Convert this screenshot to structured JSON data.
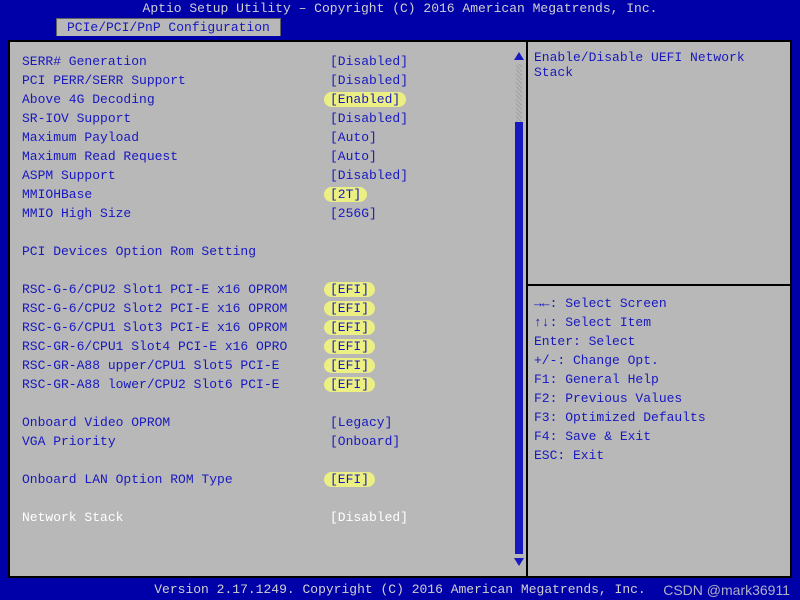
{
  "title": "Aptio Setup Utility – Copyright (C) 2016 American Megatrends, Inc.",
  "tab": "PCIe/PCI/PnP Configuration",
  "footer": "Version 2.17.1249. Copyright (C) 2016 American Megatrends, Inc.",
  "watermark": "CSDN @mark36911",
  "help_text": "Enable/Disable UEFI Network Stack",
  "section1": "PCI Devices Option Rom Setting",
  "items": {
    "serr": {
      "label": "SERR# Generation",
      "value": "[Disabled]"
    },
    "perr": {
      "label": "PCI PERR/SERR Support",
      "value": "[Disabled]"
    },
    "above4g": {
      "label": "Above 4G Decoding",
      "value": "[Enabled]"
    },
    "sriov": {
      "label": "SR-IOV Support",
      "value": "[Disabled]"
    },
    "maxpay": {
      "label": "Maximum Payload",
      "value": "[Auto]"
    },
    "maxread": {
      "label": "Maximum Read Request",
      "value": "[Auto]"
    },
    "aspm": {
      "label": "ASPM Support",
      "value": "[Disabled]"
    },
    "mmiobase": {
      "label": "MMIOHBase",
      "value": "[2T]"
    },
    "mmiohigh": {
      "label": "MMIO High Size",
      "value": "[256G]"
    },
    "slot1": {
      "label": "RSC-G-6/CPU2 Slot1 PCI-E x16 OPROM",
      "value": "[EFI]"
    },
    "slot2": {
      "label": "RSC-G-6/CPU2 Slot2 PCI-E x16 OPROM",
      "value": "[EFI]"
    },
    "slot3": {
      "label": "RSC-G-6/CPU1 Slot3 PCI-E x16 OPROM",
      "value": "[EFI]"
    },
    "slot4": {
      "label": "RSC-GR-6/CPU1 Slot4 PCI-E x16 OPRO",
      "value": "[EFI]"
    },
    "slot5": {
      "label": "RSC-GR-A88 upper/CPU1 Slot5 PCI-E",
      "value": "[EFI]"
    },
    "slot6": {
      "label": "RSC-GR-A88 lower/CPU2 Slot6 PCI-E",
      "value": "[EFI]"
    },
    "video": {
      "label": "Onboard Video OPROM",
      "value": "[Legacy]"
    },
    "vga": {
      "label": "VGA Priority",
      "value": "[Onboard]"
    },
    "lanrom": {
      "label": "Onboard LAN Option ROM Type",
      "value": "[EFI]"
    },
    "netstack": {
      "label": "Network Stack",
      "value": "[Disabled]"
    }
  },
  "keys": {
    "l1": "→←: Select Screen",
    "l2": "↑↓: Select Item",
    "l3": "Enter: Select",
    "l4": "+/-: Change Opt.",
    "l5": "F1: General Help",
    "l6": "F2: Previous Values",
    "l7": "F3: Optimized Defaults",
    "l8": "F4: Save & Exit",
    "l9": "ESC: Exit"
  }
}
